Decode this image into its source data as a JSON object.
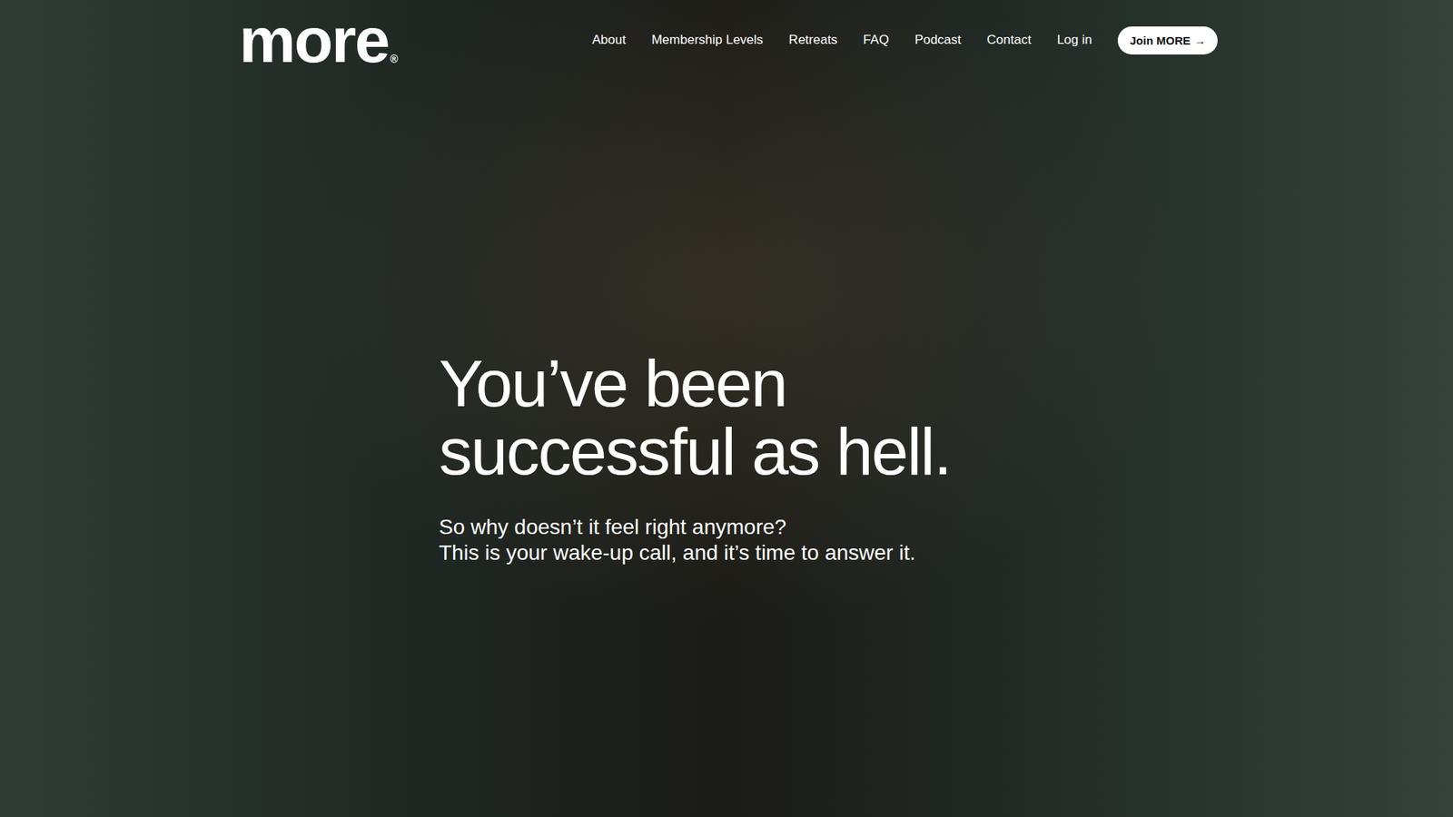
{
  "logo": {
    "text": "more",
    "mark": "®"
  },
  "nav": {
    "items": [
      {
        "label": "About"
      },
      {
        "label": "Membership Levels"
      },
      {
        "label": "Retreats"
      },
      {
        "label": "FAQ"
      },
      {
        "label": "Podcast"
      },
      {
        "label": "Contact"
      },
      {
        "label": "Log in"
      }
    ],
    "cta": {
      "label": "Join MORE",
      "icon": "→"
    }
  },
  "hero": {
    "headline": [
      "You’ve been",
      "successful as hell."
    ],
    "subtitle": [
      "So why doesn’t it feel right anymore?",
      "This is your wake-up call, and it’s time to answer it."
    ]
  }
}
